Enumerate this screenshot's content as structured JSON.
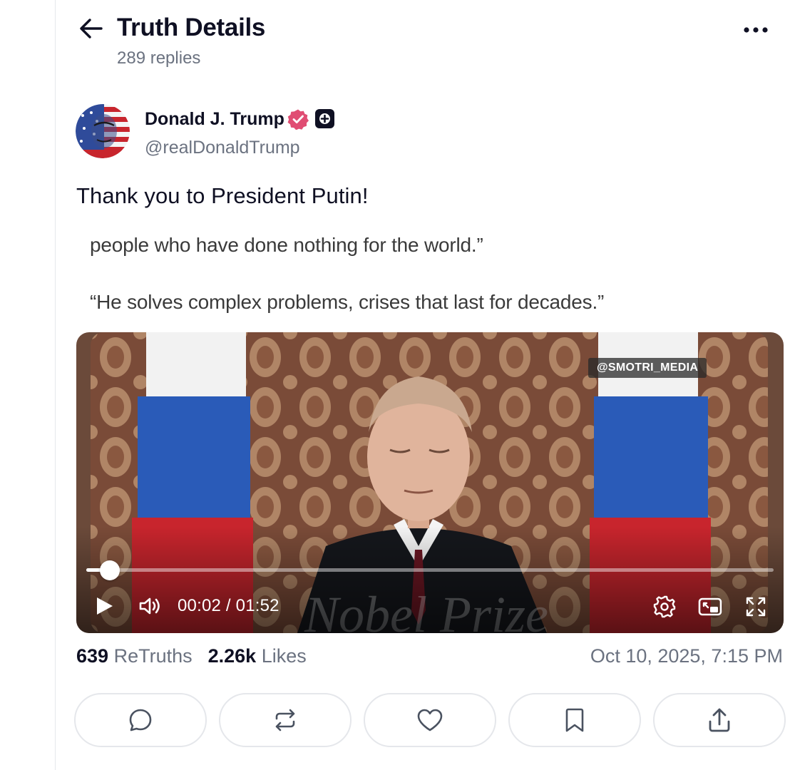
{
  "header": {
    "title": "Truth Details",
    "reply_count": "289 replies"
  },
  "author": {
    "name": "Donald J. Trump",
    "handle": "@realDonaldTrump"
  },
  "post": {
    "text": "Thank you to President Putin!",
    "image_text": {
      "line1": "people who have done nothing for the world.”",
      "line2": "“He solves complex problems, crises that last for decades.”"
    }
  },
  "video": {
    "watermark": "@SMOTRI_MEDIA",
    "current_time": "00:02",
    "duration": "01:52",
    "time_display": "00:02 / 01:52",
    "progress": 0.02
  },
  "stats": {
    "retruths_count": "639",
    "retruths_label": "ReTruths",
    "likes_count": "2.26k",
    "likes_label": "Likes",
    "date": "Oct 10, 2025, 7:15 PM"
  },
  "icons": {
    "back": "arrow-left-icon",
    "more": "more-horizontal-icon",
    "verified": "verified-badge-icon",
    "plus": "plus-badge-icon",
    "play": "play-icon",
    "volume": "volume-icon",
    "settings": "settings-icon",
    "pip": "picture-in-picture-icon",
    "fullscreen": "fullscreen-icon",
    "reply": "reply-icon",
    "retruth": "retruth-icon",
    "like": "heart-icon",
    "bookmark": "bookmark-icon",
    "share": "share-icon"
  },
  "colors": {
    "verified": "#e04d73",
    "text_primary": "#0f1023",
    "text_secondary": "#6b7280"
  }
}
